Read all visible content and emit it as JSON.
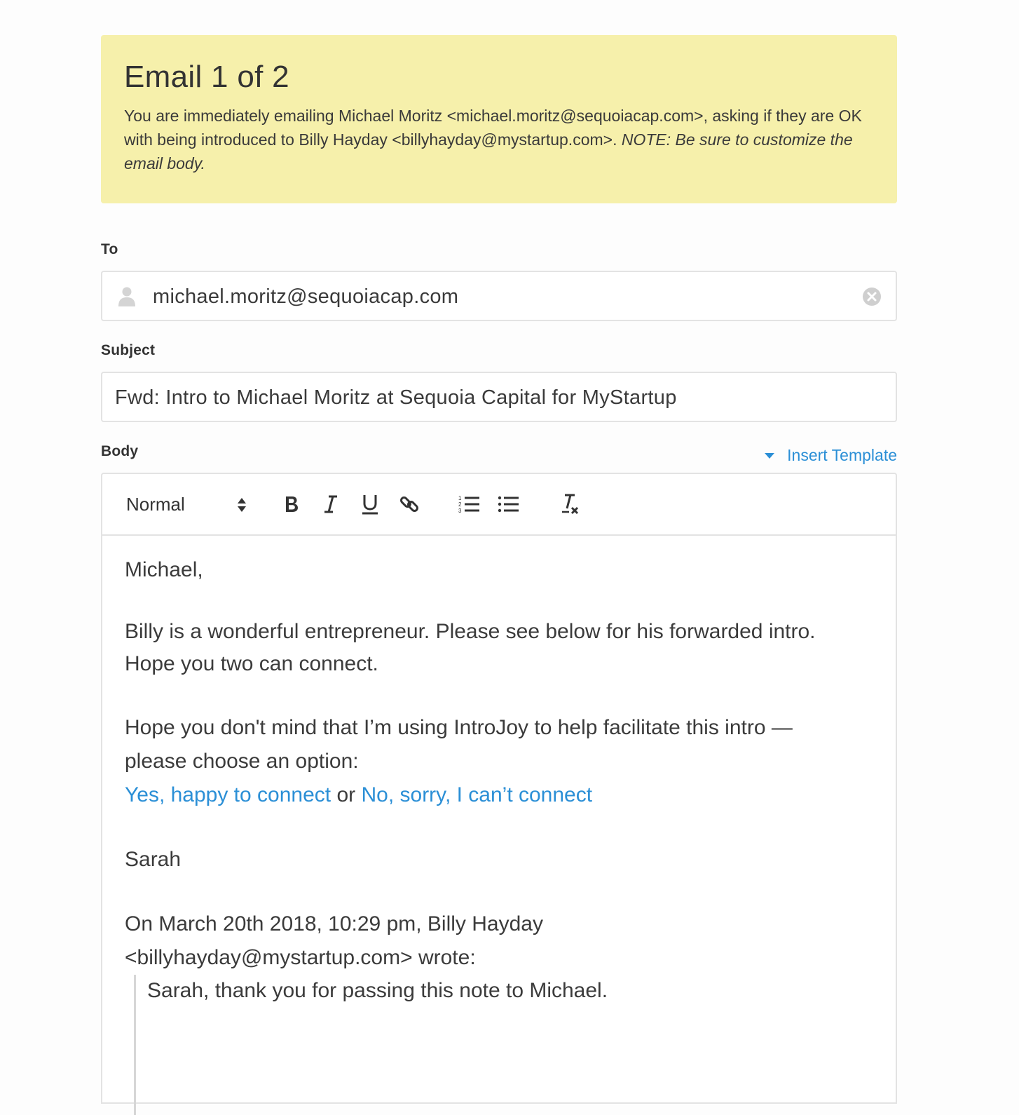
{
  "banner": {
    "title": "Email 1 of 2",
    "text": "You are immediately emailing Michael Moritz <michael.moritz@sequoiacap.com>, asking if they are OK with being introduced to Billy Hayday <billyhayday@mystartup.com>. ",
    "note": "NOTE: Be sure to customize the email body."
  },
  "to": {
    "label": "To",
    "value": "michael.moritz@sequoiacap.com",
    "person_icon": "person-icon",
    "clear_icon": "clear-circle-icon"
  },
  "subject": {
    "label": "Subject",
    "value": "Fwd: Intro to Michael Moritz at Sequoia Capital for MyStartup"
  },
  "body": {
    "label": "Body",
    "insert_template": "Insert Template",
    "toolbar": {
      "format": "Normal",
      "icons": [
        "bold-icon",
        "italic-icon",
        "underline-icon",
        "link-icon",
        "ordered-list-icon",
        "bullet-list-icon",
        "clear-format-icon"
      ]
    },
    "greeting": "Michael,",
    "para1_line1": "Billy is a wonderful entrepreneur. Please see below for his forwarded intro.",
    "para1_line2": "Hope you two can connect.",
    "para2_line1": "Hope you don't mind that I’m using IntroJoy to help facilitate this intro —",
    "para2_line2": "please choose an option:",
    "option_yes": "Yes, happy to connect",
    "option_or": " or ",
    "option_no": "No, sorry, I can’t connect",
    "signature": "Sarah",
    "quote_header_line1": "On March 20th 2018, 10:29 pm, Billy Hayday",
    "quote_header_line2": "<billyhayday@mystartup.com> wrote:",
    "quote_text": "Sarah, thank you for passing this note to Michael."
  },
  "colors": {
    "banner_bg": "#f6f0ab",
    "link": "#2b8fd6",
    "border": "#e3e3e3"
  }
}
